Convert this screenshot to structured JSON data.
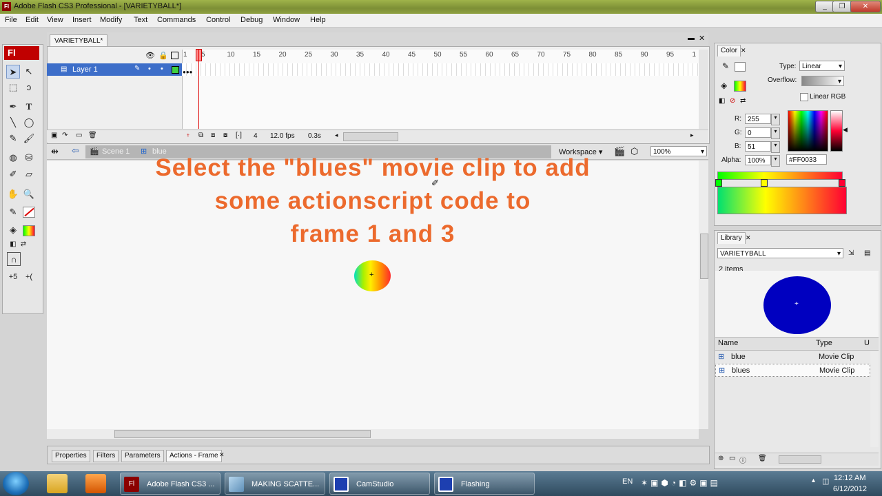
{
  "window": {
    "title": "Adobe Flash CS3 Professional - [VARIETYBALL*]",
    "app_icon": "Fl"
  },
  "menu": [
    "File",
    "Edit",
    "View",
    "Insert",
    "Modify",
    "Text",
    "Commands",
    "Control",
    "Debug",
    "Window",
    "Help"
  ],
  "document_tab": "VARIETYBALL*",
  "timeline": {
    "frame_numbers": [
      "1",
      "5",
      "10",
      "15",
      "20",
      "25",
      "30",
      "35",
      "40",
      "45",
      "50",
      "55",
      "60",
      "65",
      "70",
      "75",
      "80",
      "85",
      "90",
      "95",
      "1"
    ],
    "layer_name": "Layer 1",
    "current_frame": "4",
    "fps": "12.0 fps",
    "elapsed": "0.3s"
  },
  "edit_bar": {
    "scene": "Scene 1",
    "symbol": "blue",
    "workspace": "Workspace ▾",
    "zoom": "100%"
  },
  "instruction": {
    "line1": "Select the \"blues\" movie clip to add",
    "line2": "some actionscript code to",
    "line3": "frame 1 and 3"
  },
  "bottom_tabs": [
    "Properties",
    "Filters",
    "Parameters",
    "Actions - Frame"
  ],
  "color_panel": {
    "tab": "Color",
    "type_label": "Type:",
    "type_value": "Linear",
    "overflow_label": "Overflow:",
    "linear_rgb": "Linear RGB",
    "r_label": "R:",
    "r": "255",
    "g_label": "G:",
    "g": "0",
    "b_label": "B:",
    "b": "51",
    "alpha_label": "Alpha:",
    "alpha": "100%",
    "hex": "#FF0033"
  },
  "library_panel": {
    "tab": "Library",
    "document": "VARIETYBALL",
    "item_count": "2 items",
    "col_name": "Name",
    "col_type": "Type",
    "col_u": "U",
    "items": [
      {
        "name": "blue",
        "type": "Movie Clip"
      },
      {
        "name": "blues",
        "type": "Movie Clip"
      }
    ]
  },
  "taskbar": {
    "buttons": [
      "Adobe Flash CS3 ...",
      "MAKING SCATTE...",
      "CamStudio",
      "Flashing"
    ],
    "language": "EN",
    "time": "12:12 AM",
    "date": "6/12/2012"
  },
  "colors": {
    "instruction_text": "#ec6a2d",
    "selected_fill": "#ff0033",
    "library_preview": "#0000c0",
    "layer_selected": "#3d6ec9"
  }
}
